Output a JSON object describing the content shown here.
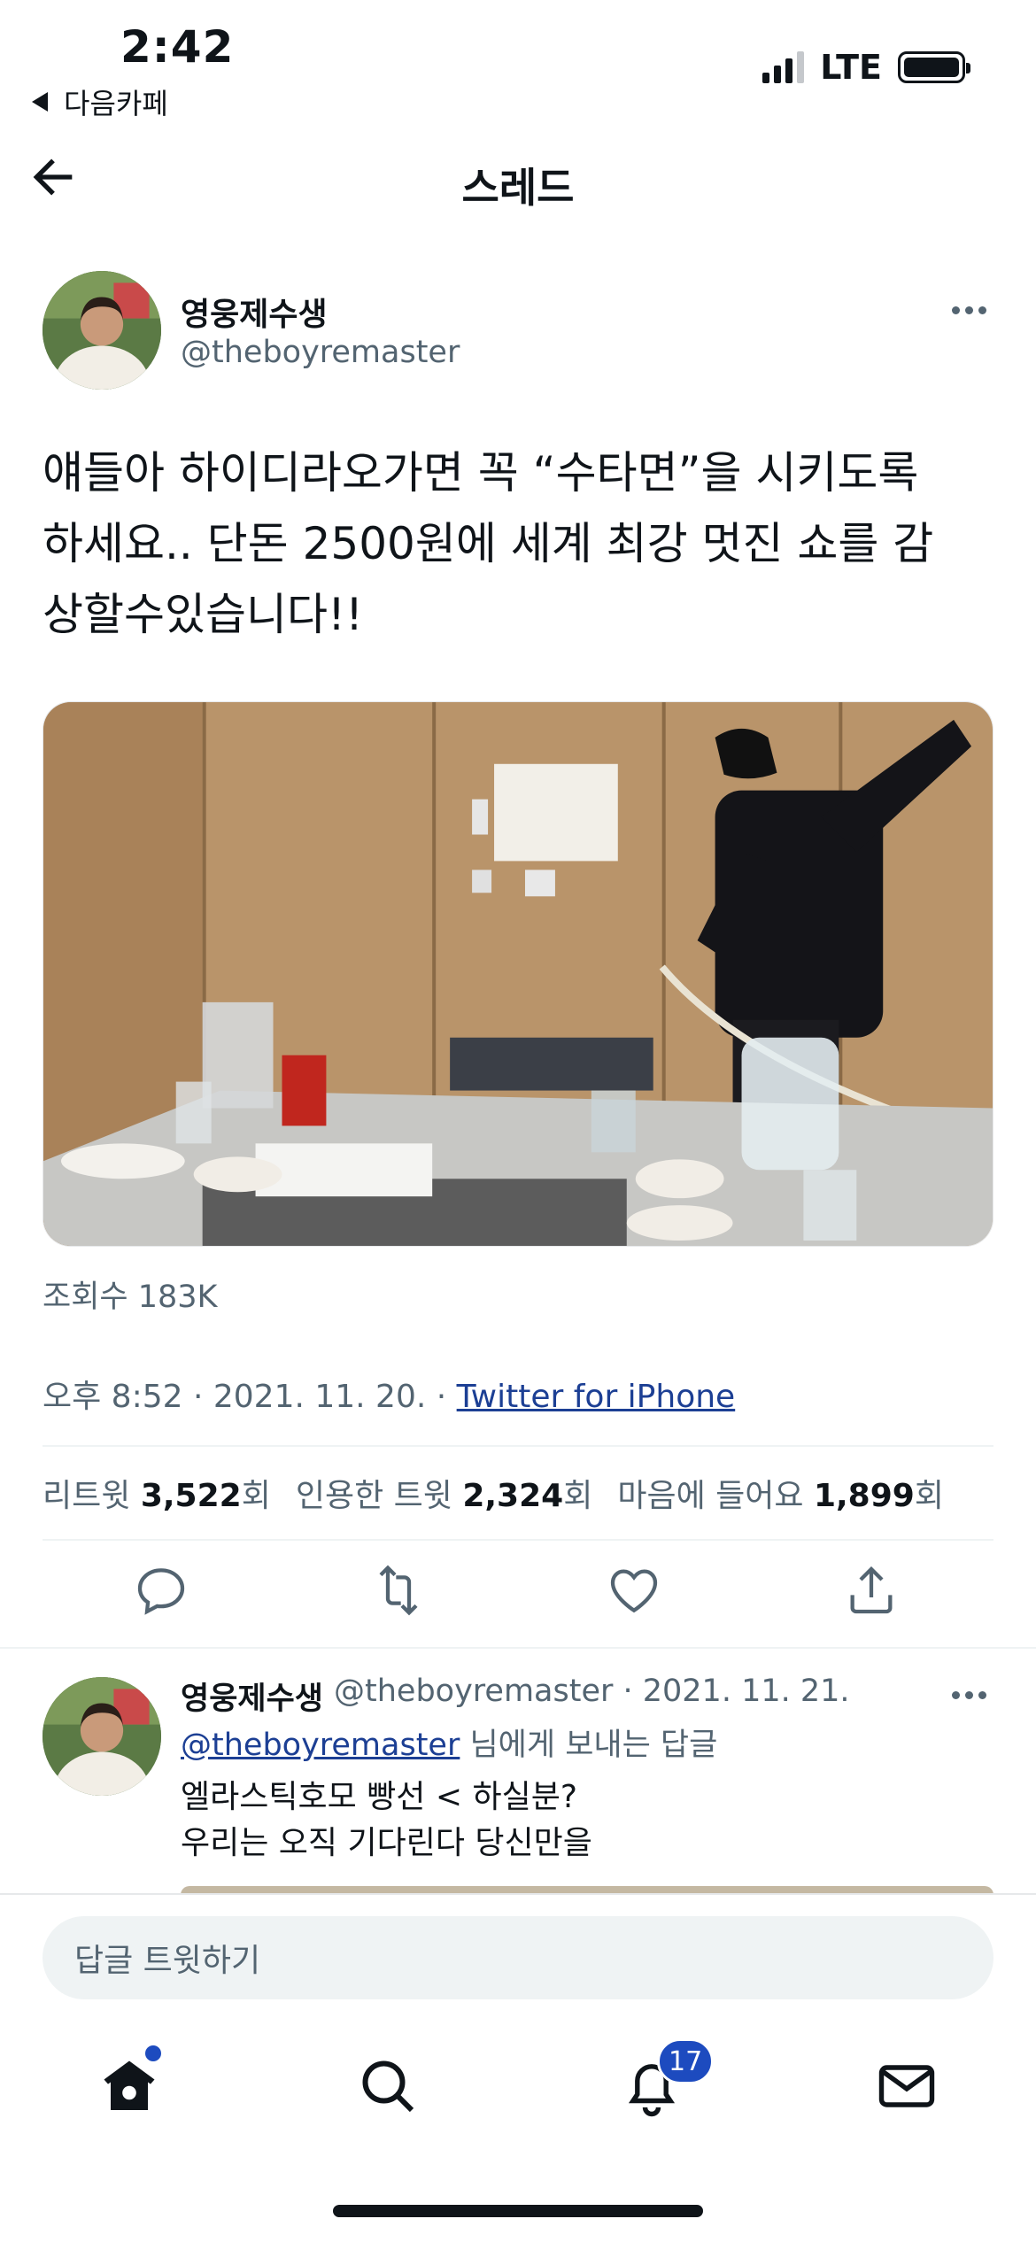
{
  "status_bar": {
    "time": "2:42",
    "back_app": "다음카페",
    "network": "LTE"
  },
  "header": {
    "title": "스레드",
    "back_icon": "arrow-left-icon"
  },
  "main_tweet": {
    "author_name": "영웅제수생",
    "author_handle": "@theboyremaster",
    "text_lines": [
      "얘들아 하이디라오가면 꼭 “수타면”을 시키도록",
      "하세요.. 단돈 2500원에 세계 최강 멋진 쇼를 감",
      "상할수있습니다!!"
    ],
    "views": "조회수 183K",
    "time": "오후 8:52 · 2021. 11. 20. · ",
    "source": "Twitter for iPhone",
    "stats": {
      "retweets_label": "리트윗",
      "retweets_count": "3,522",
      "retweets_suffix": "회",
      "quotes_label": "인용한 트윗",
      "quotes_count": "2,324",
      "quotes_suffix": "회",
      "likes_label": "마음에 들어요",
      "likes_count": "1,899",
      "likes_suffix": "회"
    },
    "action_icons": [
      "reply-icon",
      "retweet-icon",
      "like-icon",
      "share-icon"
    ]
  },
  "reply_tweet": {
    "author_name": "영웅제수생",
    "meta": "@theboyremaster · 2021. 11. 21.",
    "mention": "@theboyremaster",
    "reply_suffix": " 님에게 보내는 답글",
    "text_lines": [
      "엘라스틱호모 빵선 < 하실분?",
      "우리는 오직 기다린다 당신만을"
    ]
  },
  "compose": {
    "placeholder": "답글 트윗하기"
  },
  "tab_bar": {
    "items": [
      "home-icon",
      "search-icon",
      "notifications-icon",
      "messages-icon"
    ],
    "notification_count": "17"
  },
  "colors": {
    "text": "#0f1419",
    "secondary": "#536471",
    "link": "#1c3f94",
    "badge": "#1d4bbf"
  }
}
